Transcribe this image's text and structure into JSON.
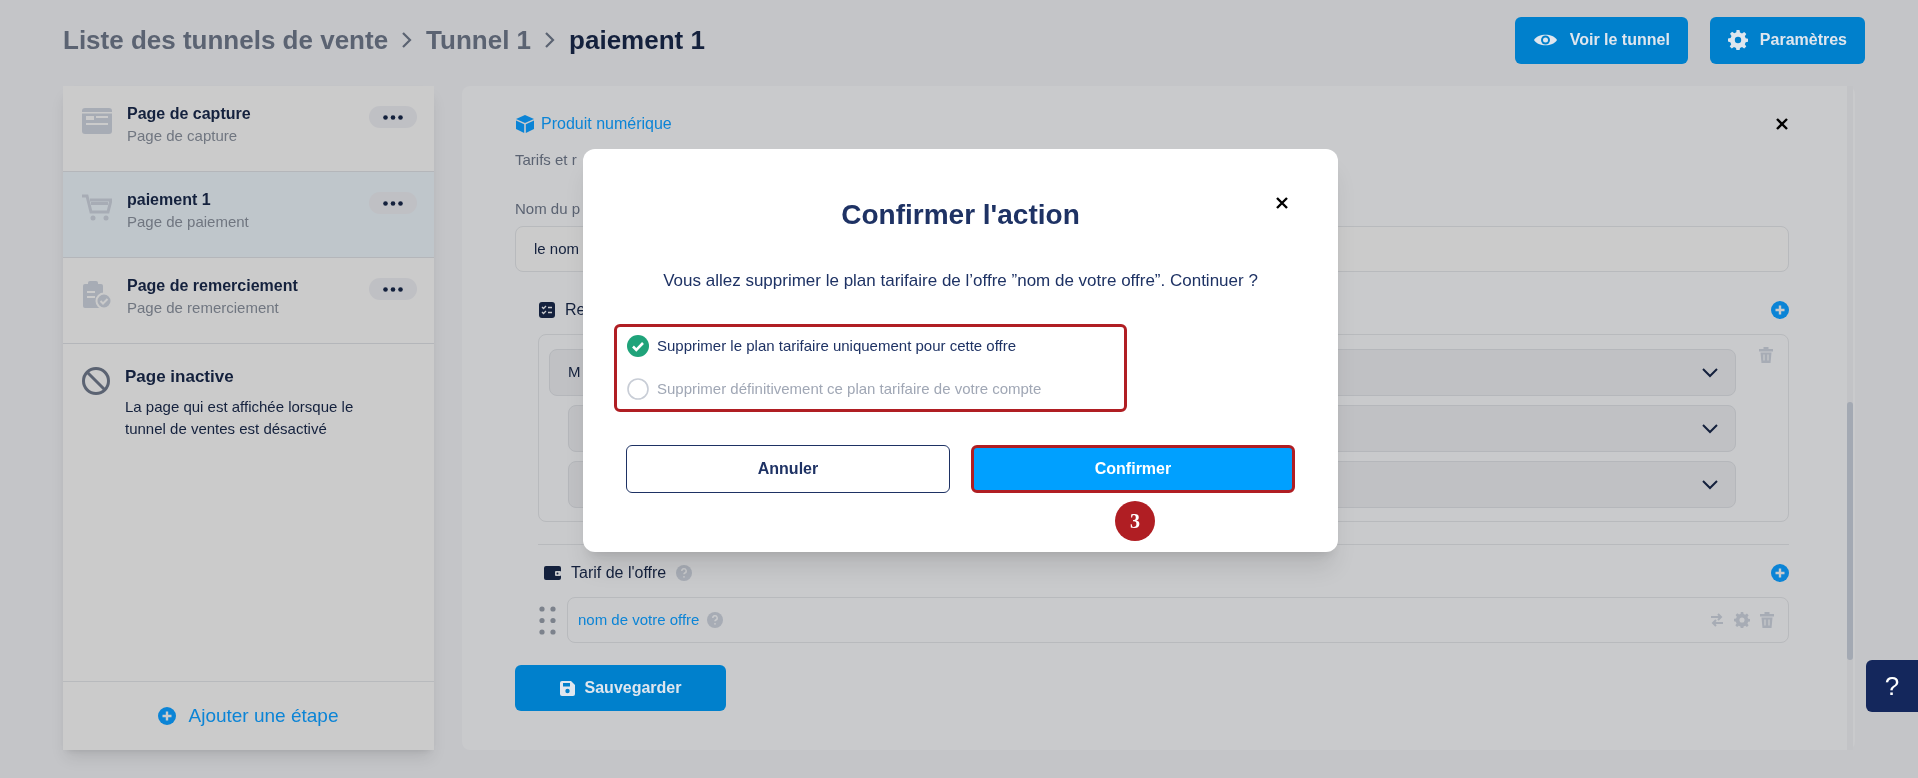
{
  "breadcrumb": [
    {
      "label": "Liste des tunnels de vente",
      "current": false
    },
    {
      "label": "Tunnel 1",
      "current": false
    },
    {
      "label": "paiement 1",
      "current": true
    }
  ],
  "header_buttons": [
    {
      "label": "Voir le tunnel",
      "kind": "view"
    },
    {
      "label": "Paramètres",
      "kind": "settings"
    }
  ],
  "sidebar": {
    "items": [
      {
        "title": "Page de capture",
        "subtitle": "Page de capture",
        "kind": "capture",
        "selected": false
      },
      {
        "title": "paiement 1",
        "subtitle": "Page de paiement",
        "kind": "payment",
        "selected": true
      },
      {
        "title": "Page de remerciement",
        "subtitle": "Page de remerciement",
        "kind": "thanks",
        "selected": false
      }
    ],
    "inactive": {
      "title": "Page inactive",
      "description": "La page qui est affichée lorsque le tunnel de ventes est désactivé"
    },
    "add_step": "Ajouter une étape"
  },
  "panel": {
    "product_link": "Produit numérique",
    "subtitle": "Tarifs et r",
    "name_label": "Nom du p",
    "name_value": "le nom",
    "section_label": "Re",
    "select_value": "M",
    "offer_section": "Tarif de l'offre",
    "offer_name": "nom de votre offre",
    "save_button": "Sauvegarder"
  },
  "modal": {
    "title": "Confirmer l'action",
    "message": "Vous allez supprimer le plan tarifaire de l’offre ”nom de votre offre”. Continuer ?",
    "options": [
      {
        "label": "Supprimer le plan tarifaire uniquement pour cette offre",
        "selected": true
      },
      {
        "label": "Supprimer définitivement ce plan tarifaire de votre compte",
        "selected": false
      }
    ],
    "buttons": [
      {
        "label": "Annuler",
        "kind": "secondary"
      },
      {
        "label": "Confirmer",
        "kind": "primary"
      }
    ],
    "step_badge": "3"
  },
  "help_button": "?"
}
